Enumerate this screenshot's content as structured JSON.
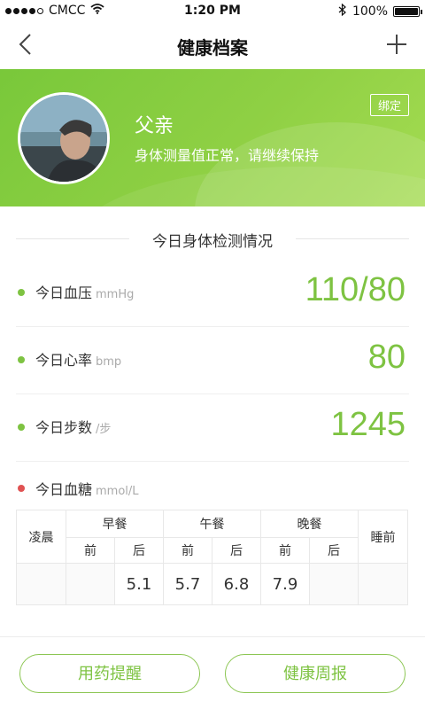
{
  "status_bar": {
    "carrier": "CMCC",
    "time": "1:20 PM",
    "battery": "100%",
    "battery_level": 1.0
  },
  "nav": {
    "title": "健康档案"
  },
  "profile": {
    "name": "父亲",
    "status": "身体测量值正常，请继续保持",
    "bind_label": "绑定"
  },
  "section": {
    "title": "今日身体检测情况"
  },
  "metrics": [
    {
      "label": "今日血压",
      "unit": "mmHg",
      "value": "110/80",
      "dot_color": "#7ec342"
    },
    {
      "label": "今日心率",
      "unit": "bmp",
      "value": "80",
      "dot_color": "#7ec342"
    },
    {
      "label": "今日步数",
      "unit": "/步",
      "value": "1245",
      "dot_color": "#7ec342"
    }
  ],
  "glucose": {
    "label": "今日血糖",
    "unit": "mmol/L",
    "dot_color": "#e05252",
    "headers": {
      "early_morning": "凌晨",
      "breakfast": "早餐",
      "lunch": "午餐",
      "dinner": "晚餐",
      "bedtime": "睡前",
      "before": "前",
      "after": "后"
    },
    "values": {
      "early_morning": "",
      "breakfast_before": "",
      "breakfast_after": "5.1",
      "lunch_before": "5.7",
      "lunch_after": "6.8",
      "dinner_before": "7.9",
      "dinner_after": "",
      "bedtime": ""
    }
  },
  "buttons": {
    "medication_reminder": "用药提醒",
    "weekly_report": "健康周报"
  },
  "colors": {
    "accent_green": "#7ec342",
    "alert_red": "#e05252"
  }
}
